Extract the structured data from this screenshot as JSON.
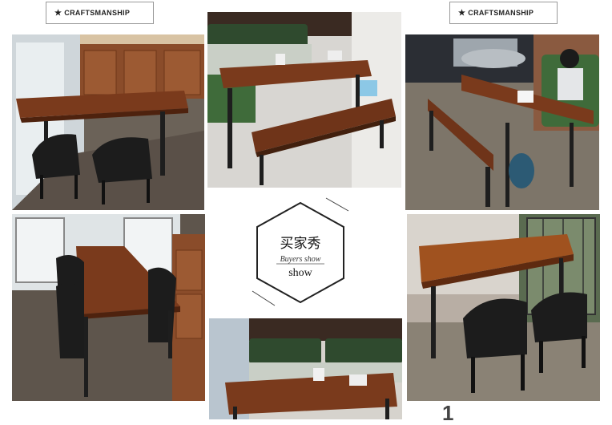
{
  "labels": {
    "craftsmanship_left": "CRAFTSMANSHIP",
    "craftsmanship_right": "CRAFTSMANSHIP",
    "star": "★"
  },
  "badge": {
    "title": "买家秀",
    "subtitle": "Buyers show",
    "word": "show"
  },
  "footer": {
    "digit": "1"
  },
  "colors": {
    "wood": "#7a3a1c",
    "wood_light": "#a0521f",
    "metal": "#1e1e1e",
    "bench_green": "#3f6b3a",
    "floor_gray": "#8a8275"
  }
}
